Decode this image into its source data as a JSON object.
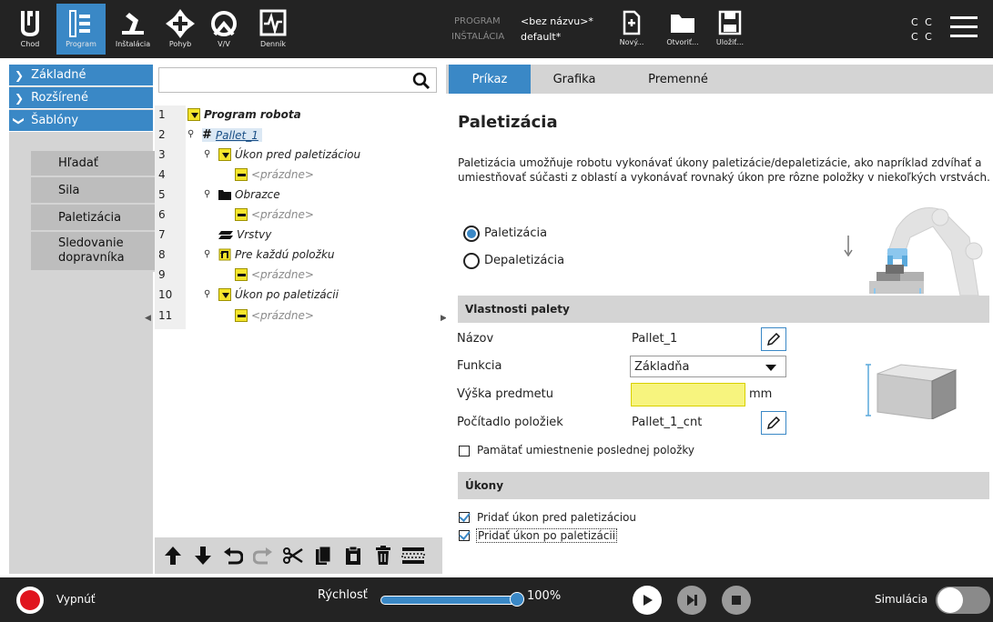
{
  "topbar": {
    "nav": [
      {
        "label": "Chod",
        "icon": "ur-logo-icon"
      },
      {
        "label": "Program",
        "icon": "program-icon",
        "active": true
      },
      {
        "label": "Inštalácia",
        "icon": "installation-icon"
      },
      {
        "label": "Pohyb",
        "icon": "move-icon"
      },
      {
        "label": "V/V",
        "icon": "io-icon"
      },
      {
        "label": "Denník",
        "icon": "log-icon"
      }
    ],
    "program_label": "PROGRAM",
    "program_value": "<bez názvu>*",
    "install_label": "INŠTALÁCIA",
    "install_value": "default*",
    "file_buttons": [
      {
        "label": "Nový...",
        "icon": "new-file-icon"
      },
      {
        "label": "Otvoriť...",
        "icon": "folder-icon"
      },
      {
        "label": "Uložiť...",
        "icon": "save-icon"
      }
    ],
    "cc_top": "C C",
    "cc_bottom": "C C",
    "menu_icon": "hamburger-menu-icon"
  },
  "leftnav": {
    "groups": [
      {
        "label": "Základné",
        "expanded": false
      },
      {
        "label": "Rozšírené",
        "expanded": false
      },
      {
        "label": "Šablóny",
        "expanded": true
      }
    ],
    "templates": [
      "Hľadať",
      "Sila",
      "Paletizácia",
      "Sledovanie dopravníka"
    ]
  },
  "tree": {
    "search_placeholder": "",
    "rows": [
      {
        "line": "1",
        "text": "Program robota",
        "icon": "yellow-triangle-icon"
      },
      {
        "line": "2",
        "text": "Pallet_1",
        "icon": "grid-icon"
      },
      {
        "line": "3",
        "text": "Úkon pred paletizáciou",
        "icon": "yellow-triangle-icon"
      },
      {
        "line": "4",
        "text": "<prázdne>",
        "icon": "yellow-dash-icon"
      },
      {
        "line": "5",
        "text": "Obrazce",
        "icon": "folder-icon"
      },
      {
        "line": "6",
        "text": "<prázdne>",
        "icon": "yellow-dash-icon"
      },
      {
        "line": "7",
        "text": "Vrstvy",
        "icon": "layers-icon"
      },
      {
        "line": "8",
        "text": "Pre každú položku",
        "icon": "loop-icon"
      },
      {
        "line": "9",
        "text": "<prázdne>",
        "icon": "yellow-dash-icon"
      },
      {
        "line": "10",
        "text": "Úkon po paletizácii",
        "icon": "yellow-triangle-icon"
      },
      {
        "line": "11",
        "text": "<prázdne>",
        "icon": "yellow-dash-icon"
      }
    ],
    "toolbar_icons": [
      "arrow-up-icon",
      "arrow-down-icon",
      "undo-icon",
      "redo-icon",
      "cut-icon",
      "copy-icon",
      "paste-icon",
      "delete-icon",
      "suppress-icon"
    ]
  },
  "content": {
    "tabs": [
      "Príkaz",
      "Grafika",
      "Premenné"
    ],
    "title": "Paletizácia",
    "description": "Paletizácia umožňuje robotu vykonávať úkony paletizácie/depaletizácie, ako napríklad zdvíhať a umiestňovať súčasti z oblastí a vykonávať rovnaký úkon pre rôzne položky v niekoľkých vrstvách.",
    "mode_options": [
      {
        "label": "Paletizácia",
        "selected": true
      },
      {
        "label": "Depaletizácia",
        "selected": false
      }
    ],
    "pallet_section": "Vlastnosti palety",
    "props": {
      "name_label": "Názov",
      "name_value": "Pallet_1",
      "function_label": "Funkcia",
      "function_value": "Základňa",
      "height_label": "Výška predmetu",
      "height_value": "",
      "height_unit": "mm",
      "counter_label": "Počítadlo položiek",
      "counter_value": "Pallet_1_cnt"
    },
    "remember_label": "Pamätať umiestnenie poslednej položky",
    "remember_checked": false,
    "actions_section": "Úkony",
    "actions": [
      {
        "label": "Pridať úkon pred paletizáciou",
        "checked": true
      },
      {
        "label": "Pridať úkon po paletizácii",
        "checked": true
      }
    ]
  },
  "footer": {
    "power_label": "Vypnúť",
    "speed_label": "Rýchlosť",
    "speed_value": "100%",
    "speed_fraction": 1.0,
    "sim_label": "Simulácia",
    "sim_on": false
  },
  "colors": {
    "accent": "#3a88c6",
    "topbar": "#232323",
    "panel_gray": "#d4d4d4",
    "power_red": "#e0141e",
    "highlight_yellow": "#f7f47e"
  }
}
